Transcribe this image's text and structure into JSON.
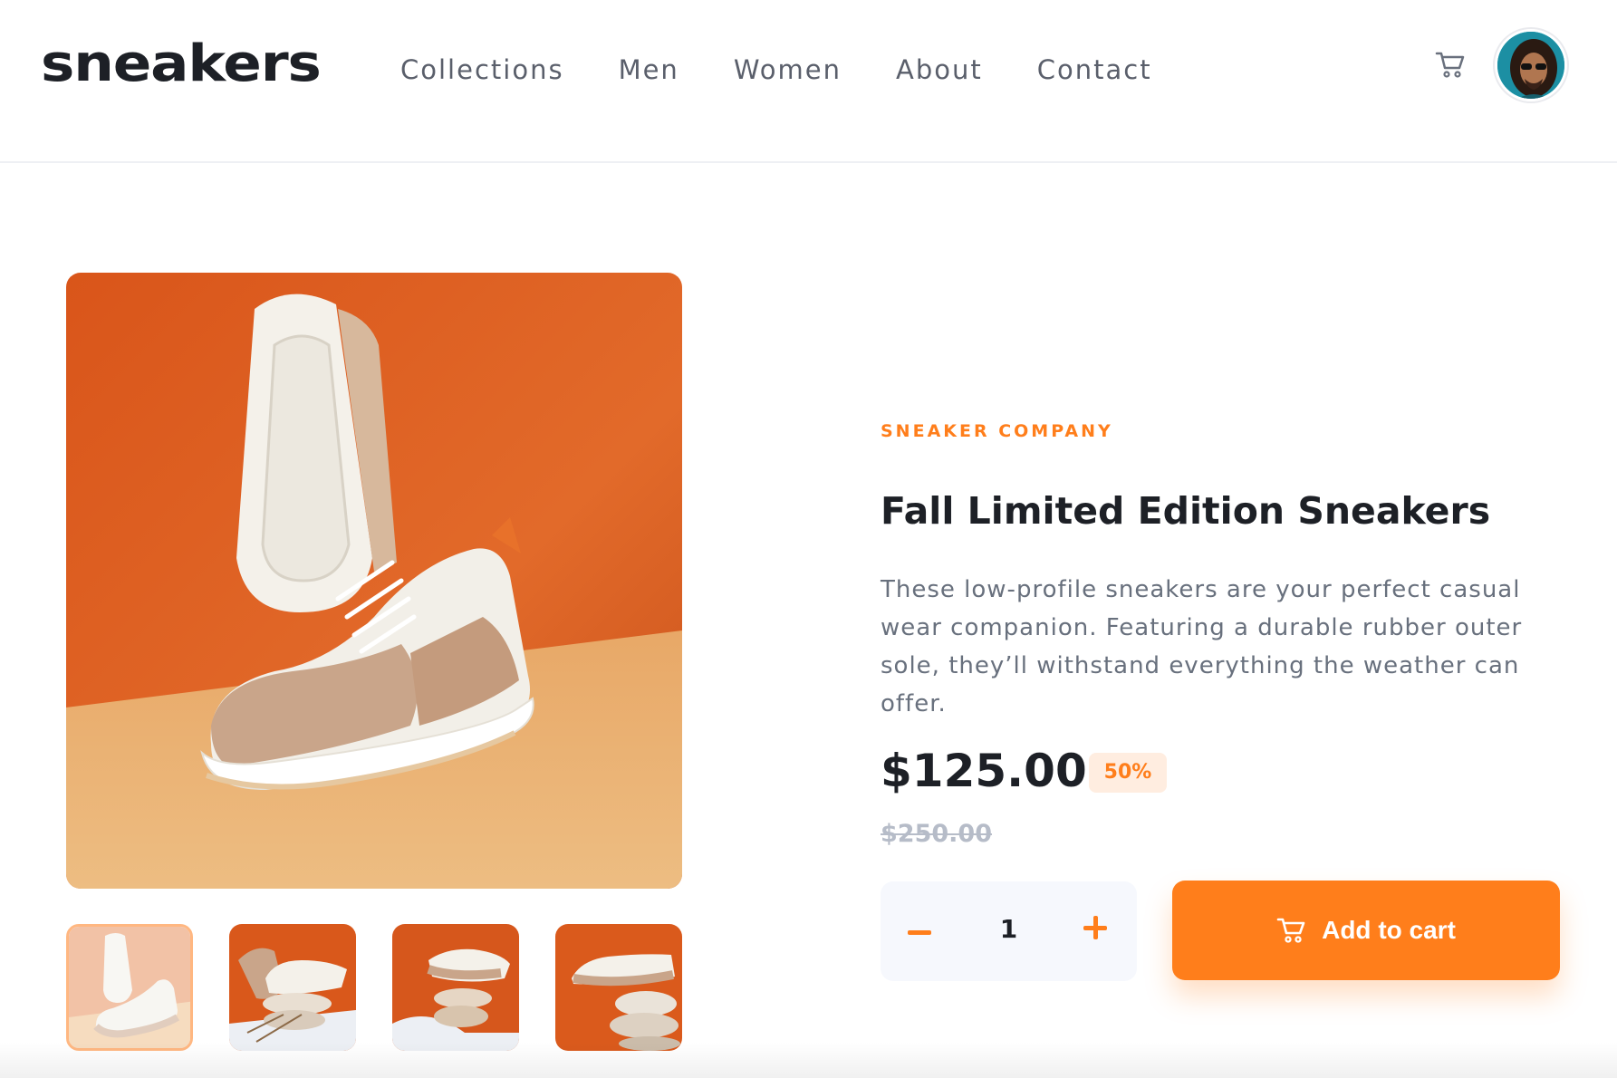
{
  "header": {
    "logo": "sneakers",
    "nav": [
      "Collections",
      "Men",
      "Women",
      "About",
      "Contact"
    ],
    "cart_icon": "cart-icon",
    "avatar_icon": "user-avatar"
  },
  "gallery": {
    "main_image": "sneaker-photo",
    "thumbnails": [
      "thumbnail-1",
      "thumbnail-2",
      "thumbnail-3",
      "thumbnail-4"
    ],
    "active_thumbnail": 1
  },
  "product": {
    "company": "SNEAKER COMPANY",
    "title": "Fall Limited Edition Sneakers",
    "description": "These low-profile sneakers are your perfect casual wear companion. Featuring a durable rubber outer sole, they’ll withstand everything the weather can offer.",
    "price": "$125.00",
    "discount": "50%",
    "original_price": "$250.00"
  },
  "quantity": {
    "value": "1",
    "minus_icon": "minus-icon",
    "plus_icon": "plus-icon"
  },
  "cart_button": {
    "label": "Add to cart",
    "icon": "cart-icon"
  },
  "colors": {
    "accent": "#ff7e1b",
    "accent_light": "#ffede0",
    "text_dark": "#1d2026",
    "text_muted": "#68707d",
    "background_orange": "#e35f1c",
    "floor_tan": "#e9b27a"
  }
}
